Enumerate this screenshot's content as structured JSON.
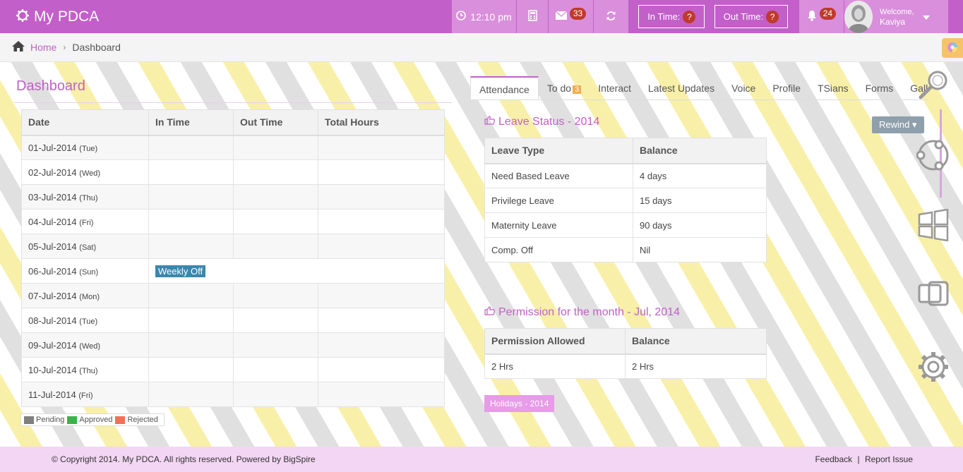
{
  "app": {
    "title": "My PDCA"
  },
  "header": {
    "time": "12:10 pm",
    "mail_count": "33",
    "in_time_label": "In Time:",
    "in_time_badge": "?",
    "out_time_label": "Out Time:",
    "out_time_badge": "?",
    "notification_count": "24",
    "welcome": "Welcome,",
    "user_name": "Kaviya"
  },
  "breadcrumb": {
    "home": "Home",
    "current": "Dashboard"
  },
  "dashboard": {
    "title": "Dashboard",
    "columns": [
      "Date",
      "In Time",
      "Out Time",
      "Total Hours"
    ],
    "rows": [
      {
        "date": "01-Jul-2014",
        "day": "(Tue)"
      },
      {
        "date": "02-Jul-2014",
        "day": "(Wed)"
      },
      {
        "date": "03-Jul-2014",
        "day": "(Thu)"
      },
      {
        "date": "04-Jul-2014",
        "day": "(Fri)"
      },
      {
        "date": "05-Jul-2014",
        "day": "(Sat)"
      },
      {
        "date": "06-Jul-2014",
        "day": "(Sun)",
        "note": "Weekly Off"
      },
      {
        "date": "07-Jul-2014",
        "day": "(Mon)"
      },
      {
        "date": "08-Jul-2014",
        "day": "(Tue)"
      },
      {
        "date": "09-Jul-2014",
        "day": "(Wed)"
      },
      {
        "date": "10-Jul-2014",
        "day": "(Thu)"
      },
      {
        "date": "11-Jul-2014",
        "day": "(Fri)"
      }
    ],
    "legend": [
      {
        "label": "Pending",
        "color": "#7f7f7f"
      },
      {
        "label": "Approved",
        "color": "#3cb34a"
      },
      {
        "label": "Rejected",
        "color": "#f07058"
      }
    ]
  },
  "tabs": [
    {
      "label": "Attendance",
      "active": true
    },
    {
      "label": "To do",
      "badge": "3"
    },
    {
      "label": "Interact"
    },
    {
      "label": "Latest Updates"
    },
    {
      "label": "Voice"
    },
    {
      "label": "Profile"
    },
    {
      "label": "TSians"
    },
    {
      "label": "Forms"
    },
    {
      "label": "Galle"
    }
  ],
  "leave": {
    "title": "Leave Status - 2014",
    "rewind": "Rewind",
    "columns": [
      "Leave Type",
      "Balance"
    ],
    "rows": [
      [
        "Need Based Leave",
        "4 days"
      ],
      [
        "Privilege Leave",
        "15 days"
      ],
      [
        "Maternity Leave",
        "90 days"
      ],
      [
        "Comp. Off",
        "Nil"
      ]
    ]
  },
  "permission": {
    "title": "Permission for the month - Jul, 2014",
    "columns": [
      "Permission Allowed",
      "Balance"
    ],
    "rows": [
      [
        "2 Hrs",
        "2 Hrs"
      ]
    ]
  },
  "holidays": {
    "label": "Holidays - 2014"
  },
  "footer": {
    "copyright": "© Copyright 2014. My PDCA. All rights reserved. Powered by BigSpire",
    "feedback": "Feedback",
    "divider": "|",
    "report": "Report Issue"
  },
  "colors": {
    "brand": "#c25fc8",
    "accent": "#d98fdb",
    "badge": "#c0392b"
  }
}
